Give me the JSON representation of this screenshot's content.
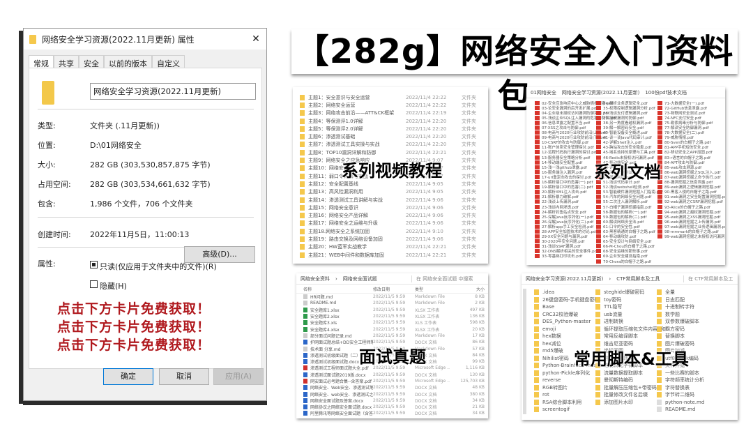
{
  "dialog": {
    "title": "网络安全学习资源(2022.11月更新) 属性",
    "close": "✕",
    "tabs": [
      "常规",
      "共享",
      "安全",
      "以前的版本",
      "自定义"
    ],
    "folder_name": "网络安全学习资源(2022.11月更新)",
    "fields": [
      {
        "k": "类型:",
        "v": "文件夹 (.11月更新))"
      },
      {
        "k": "位置:",
        "v": "D:\\01网络安全"
      },
      {
        "k": "大小:",
        "v": "282 GB (303,530,857,875 字节)"
      },
      {
        "k": "占用空间:",
        "v": "282 GB (303,534,661,632 字节)"
      },
      {
        "k": "包含:",
        "v": "1,986 个文件，706 个文件夹"
      }
    ],
    "created_label": "创建时间:",
    "created": "2022年11月5日，11:00:13",
    "attr_label": "属性:",
    "readonly": "只读(仅应用于文件夹中的文件)(R)",
    "readonly_checked": true,
    "hidden": "隐藏(H)",
    "hidden_checked": false,
    "advanced": "高级(D)...",
    "promo": [
      "点击下方卡片免费获取！",
      "点击下方卡片免费获取！",
      "点击下方卡片免费获取！"
    ],
    "ok": "确定",
    "cancel": "取消",
    "apply": "应用(A)"
  },
  "banner": "【282g】网络安全入门资料包",
  "videos": {
    "overlay": "系列视频教程",
    "type": "文件夹",
    "items": [
      [
        "主题1：安全意识与安全运营",
        "2022/11/4 22:22"
      ],
      [
        "主题2：网络安全运营",
        "2022/11/4 22:22"
      ],
      [
        "主题3：网络攻击前沿——ATT&CK框架",
        "2022/11/4 22:19"
      ],
      [
        "主题4：等保测评1.0详解",
        "2022/11/4 22:20"
      ],
      [
        "主题5：等保测评2.0详解",
        "2022/11/4 22:20"
      ],
      [
        "主题6：渗透测试基础",
        "2022/11/4 22:20"
      ],
      [
        "主题7：渗透测试工具实操与实战",
        "2022/11/4 22:20"
      ],
      [
        "主题8：TOP10漏洞详解和防御",
        "2022/11/4 22:21"
      ],
      [
        "主题9：网络安全之应急响应",
        "2022/11/4 9:07"
      ],
      [
        "主题10：网络安全",
        "2022/11/4 9:07"
      ],
      [
        "主题11：弱口令详解与实战",
        "2022/11/4 9:07"
      ],
      [
        "主题12：安全配置基线",
        "2022/11/4 9:05"
      ],
      [
        "主题13：高风险漏洞利用",
        "2022/11/4 9:05"
      ],
      [
        "主题14：渗透测试工具讲解与实战",
        "2022/11/4 9:06"
      ],
      [
        "主题15：网络安全意识",
        "2022/11/4 9:06"
      ],
      [
        "主题16：网络安全产品详解",
        "2022/11/4 9:06"
      ],
      [
        "主题17：网络安全之运维与升级",
        "2022/11/4 9:06"
      ],
      [
        "主题18.网络安全之系统加固",
        "2022/11/4 9:10"
      ],
      [
        "主题19：路由交换及网络设备加固",
        "2022/11/4 9:06"
      ],
      [
        "主题20：HW蓝军实战教学",
        "2022/11/4 22:21"
      ],
      [
        "主题21：WEB中间件和数据库加固",
        "2022/11/4 22:21"
      ]
    ]
  },
  "docs": {
    "overlay": "系列文档",
    "breadcrumb": [
      "01网络安全",
      "网络安全学习资源(2022.11月更新)",
      "100份pdf技术文档"
    ],
    "cols": [
      [
        "02-安全应急响应中心之威胁情报探索.pdf",
        "03-论安全漏洞的后开发扩展.pdf",
        "04-企业级未授权访问漏洞防御实践.pdf",
        "05-浅谈企业SQL注入漏洞的危害与防御.pdf",
        "06-信息泄露之配置不当.pdf",
        "07-XSS之攻击与防御.pdf",
        "08-电商与2020行业攻防前沿(上).pdf",
        "09-电商与2020行业攻防前沿(下).pdf",
        "10-CSRF的攻击与防御.pdf",
        "11-账户体系安全管理探讨.pdf",
        "12-远程代码执行漏洞的探讨.pdf",
        "13-服务器安全策略分析.pdf",
        "14-移动端安全配置.pdf",
        "15-浅一浅github泄露.pdf",
        "16-服务端注入漏洞.pdf",
        "17-url重定向攻击的探讨.pdf",
        "18-解析接口中的危害(一).pdf",
        "19-解析接口中的危害(二).pdf",
        "20-解析XML注入攻击.pdf",
        "21-解析暴力破解.pdf",
        "22-浅谈上传漏洞.pdf",
        "23-浅谈内网渗透.pdf",
        "24-解析钓鱼站点安全.pdf",
        "25-深解Java反序列化(一).pdf",
        "26-深解Java反序列化(二).pdf",
        "27-解析app手工安全检测.pdf",
        "28-APP安全加固技术的讨论.pdf",
        "29-XX安全问题与漏洞.pdf",
        "30-2020年安全问题.pdf",
        "31-浅谈SSRF漏洞.pdf",
        "32-DNS解析相关的安全事件.pdf",
        "33-零基础打印攻击.pdf"
      ],
      [
        "34-解析业务逻辑安全.pdf",
        "35-权限控制逻辑漏洞分析.pdf",
        "36-浅谈支付逻辑漏洞.pdf",
        "37-授权漏洞的防御.pdf",
        "38-另一角度看越权漏洞.pdf",
        "39-解一解密码安全.pdf",
        "40-智能设备安全概述.pdf",
        "41-谈一谈Java代码审计.pdf",
        "42-详解Shell注入.pdf",
        "43-跨站攻击的安全隐患.pdf",
        "45-域名劫持的原理与工具.pdf",
        "46-Redis未授权访问漏洞.pdf",
        "47-移动端安全.pdf",
        "48-详解ssrf.pdf",
        "49-浅谈安全测试.pdf",
        "50-漏洞利用.pdf",
        "51-浅谈代码审计.pdf",
        "52-浅谈webshell检测.pdf",
        "53-智能硬件漏洞挖掘入门指南.pdf",
        "54-汽车的网络安全问题.pdf",
        "55-二次注入漏洞解析.pdf",
        "57-白帽子漏洞挖掘指南.pdf",
        "58-数据包的解析(一).pdf",
        "59-数据包的解析(二).pdf",
        "60-解读网络安全法.pdf",
        "61-口令的安全性.pdf",
        "63-黑客精通的白帽子之路.pdf",
        "64-移动端攻防.pdf",
        "65-安全设计与网络安全.pdf",
        "66-M-Chou的白帽子之路.pdf",
        "68-安全运维的那些事.pdf",
        "69-企业安全建设指南.pdf",
        "70-Chora的白帽子之路.pdf"
      ],
      [
        "71-大数据安全(一).pdf",
        "72-GitHub信息泄露.pdf",
        "73-物联网安全测试.pdf",
        "74-NFC支付安全.pdf",
        "75-勒索病毒分析与防御.pdf",
        "77-解读安全防御漏洞.pdf",
        "78-大数据安全(二).pdf",
        "79-威胁情报.pdf",
        "80-Sven的白帽子之路.pdf",
        "81-APP手机短信安全.pdf",
        "82-移动安全之APP加固.pdf",
        "83-r语言的白帽子之路.pdf",
        "84-APT攻击与防御.pdf",
        "85-web攻击溯源.pdf",
        "86-web漏洞挖掘之SQL注入.pdf",
        "87-web漏洞挖掘之命令执行.pdf",
        "88-漏洞挖掘之信息泄露.pdf",
        "89-web漏洞之逻辑漏洞挖掘.pdf",
        "90-黑客入侵的白帽子之路.pdf",
        "91-web漏洞之安全配置漏洞挖掘.pdf",
        "92-web漏洞之CSRF漏洞挖掘.pdf",
        "93-Alice的白帽子之路.pdf",
        "94-web漏洞之越权漏洞挖掘.pdf",
        "95-web漏洞之XSS漏洞挖掘.pdf",
        "96-web漏洞挖掘之上传漏洞.pdf",
        "97-web漏洞挖掘之业务逻辑漏洞.pdf",
        "98-mmmark的白帽子之路.pdf",
        "99-web漏洞挖掘之未授权访问漏洞.pdf"
      ]
    ]
  },
  "interview": {
    "overlay": "面试真题",
    "breadcrumb": [
      "网络安全资料",
      "网络安全面试题"
    ],
    "search_placeholder": "在 网络安全面试题 中搜索",
    "headers": [
      "名称",
      "修改日期",
      "类型",
      "大小"
    ],
    "rows": [
      [
        "HR问题.md",
        "2022/11/5 9:59",
        "Markdown File",
        "8 KB",
        "md"
      ],
      [
        "README.md",
        "2022/11/5 9:59",
        "Markdown File",
        "2 KB",
        "md"
      ],
      [
        "安全题库1.xlsx",
        "2022/11/5 9:59",
        "XLSX 工作表",
        "497 KB",
        "xls"
      ],
      [
        "安全题库2.xlsx",
        "2022/11/5 9:59",
        "XLSX 工作表",
        "136 KB",
        "xls"
      ],
      [
        "安全题库3.xls",
        "2022/11/5 9:59",
        "XLS 工作表",
        "598 KB",
        "xls"
      ],
      [
        "安全题库4.xlsx",
        "2022/11/5 9:59",
        "XLSX 工作表",
        "20 KB",
        "xls"
      ],
      [
        "部分面试问题记录.md",
        "2022/11/5 9:59",
        "Markdown File",
        "17 KB",
        "md"
      ],
      [
        "护网面试题总结+DD安全工程师笔试题...",
        "2022/11/5 9:59",
        "DOCX 文档",
        "86 KB",
        "doc"
      ],
      [
        "技术面 分享.md",
        "2022/11/5 9:59",
        "Markdown File",
        "57 KB",
        "md"
      ],
      [
        "渗透测试初级面试题（二）.docx",
        "2022/11/5 9:59",
        "DOCX 文档",
        "84 KB",
        "doc"
      ],
      [
        "渗透测试初级面试题.docx",
        "2022/11/5 9:59",
        "DOCX 文档",
        "99 KB",
        "doc"
      ],
      [
        "渗透测试工程师面试题大全.pdf",
        "2022/11/5 9:59",
        "Microsoft Edge ...",
        "1,116 KB",
        "pdf"
      ],
      [
        "渗透测试面试题2019版.docx",
        "2022/11/5 9:59",
        "DOCX 文档",
        "130 KB",
        "doc"
      ],
      [
        "网安面试必考题合集--含答案.pdf",
        "2022/11/5 9:59",
        "Microsoft Edge ...",
        "125,703 KB",
        "pdf"
      ],
      [
        "网络安全、Web安全、渗透测试笔试总...",
        "2022/11/5 9:59",
        "DOCX 文档",
        "48 KB",
        "doc"
      ],
      [
        "网络安全、web安全、渗透测试之笔试总...",
        "2022/11/5 9:59",
        "DOCX 文档",
        "380 KB",
        "doc"
      ],
      [
        "网络安全面试题及答案.docx",
        "2022/11/5 9:59",
        "DOCX 文档",
        "34 KB",
        "doc"
      ],
      [
        "网络协议之网络安全面试题.docx",
        "2022/11/5 9:59",
        "DOCX 文档",
        "21 KB",
        "doc"
      ],
      [
        "阿里腾讯等网络安全面试题（含答案）...",
        "2022/11/5 9:59",
        "DOCX 文档",
        "34 KB",
        "doc"
      ]
    ]
  },
  "tools": {
    "overlay": "常用脚本&工具",
    "breadcrumb": [
      "网络安全学习资源(2022.11月更新)",
      "CTF常用脚本及工具"
    ],
    "search_placeholder": "在 CTF常用脚本及工",
    "cols": [
      [
        ".idea",
        "26键盘密码-手机键盘密码",
        "Base",
        "CRC32校验爆破",
        "DES_Python-master",
        "emoji",
        "hex数据",
        "hex减位",
        "md5爆破",
        "Nihilist密码",
        "Python-Brainfuck-master",
        "python-Pickle序列化",
        "reverse",
        "RGB转图片",
        "rot",
        "RSA综合脚本利用",
        "screentogif"
      ],
      [
        "steghide爆破密码",
        "toy密码",
        "TTL隐写",
        "usb流量",
        "进制转换",
        "循环提取压缩包文件内容1和0",
        "常用反编译脚本",
        "维吉尼亚密码",
        "坐标画图",
        "进制互相转换",
        "进制转化字符脚本",
        "流量数据提取脚本",
        "曼彻斯特编码",
        "批量解压压缩包+带密码",
        "批量修改文件名后缀",
        "添加图片水印"
      ],
      [
        "全量",
        "日志匹配",
        "十进制转字符",
        "数学题",
        "双参数爆破脚本",
        "四方密码",
        "替换脚本",
        "图片爆破密码",
        "图片加减",
        "utf8和gbk编码",
        "文件异或",
        "一些比赛的脚本",
        "字符频率统计分析",
        "字符替换表",
        "字节转二维码",
        "python-note.md",
        "README.md"
      ]
    ]
  }
}
